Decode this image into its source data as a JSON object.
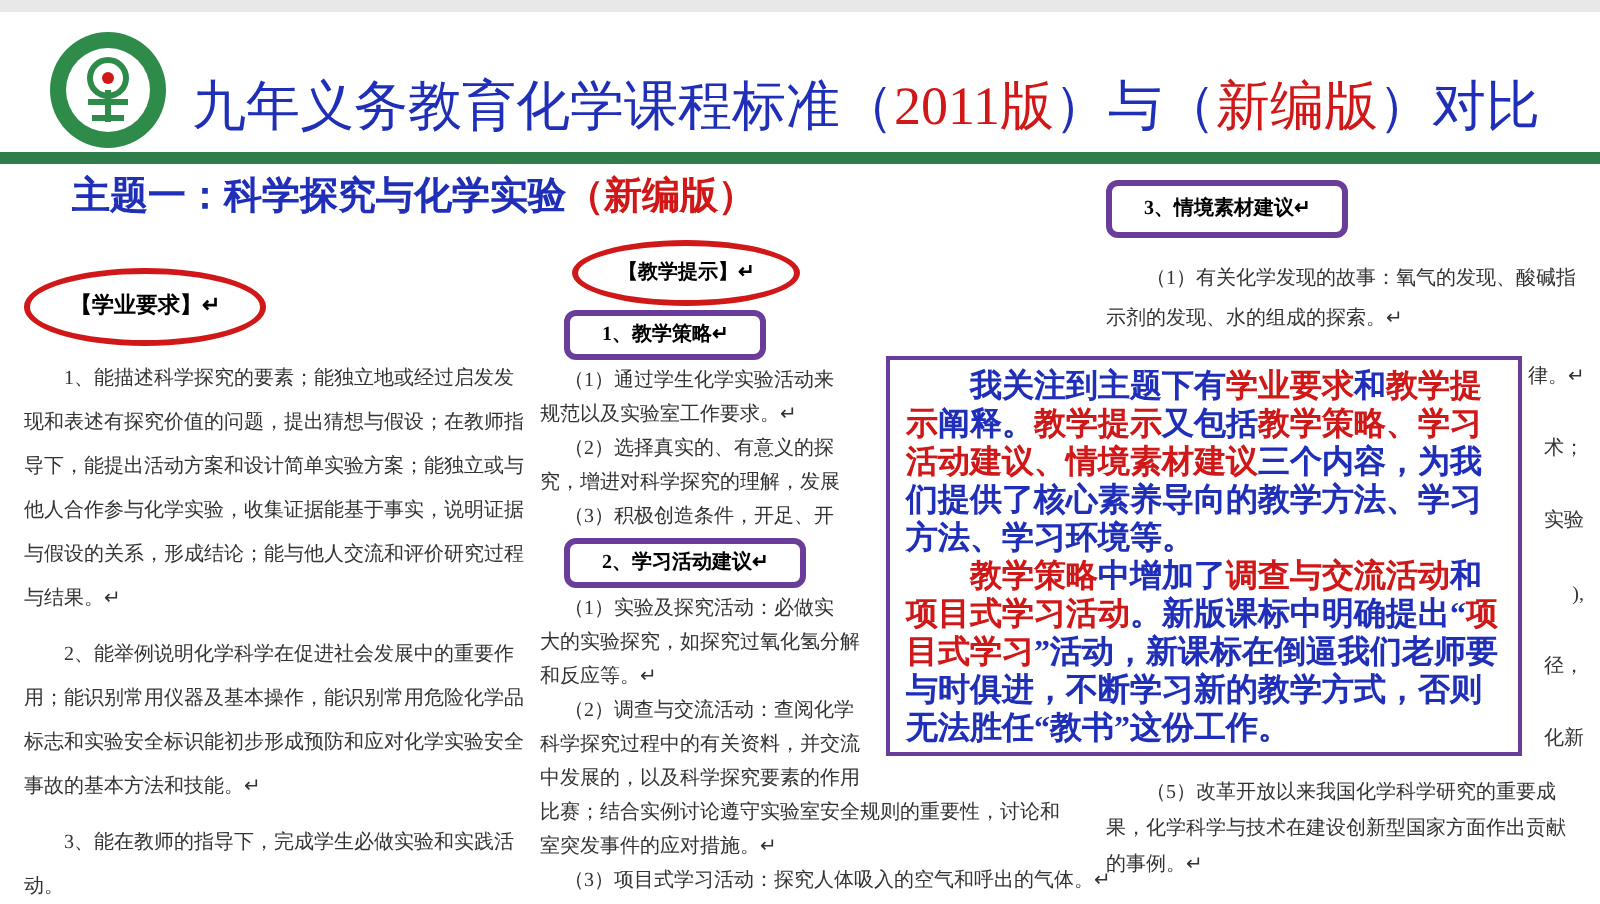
{
  "title": [
    {
      "text": "九年义务教育化学课程标准（",
      "emphasis": false
    },
    {
      "text": "2011版",
      "emphasis": true
    },
    {
      "text": "）与（",
      "emphasis": false
    },
    {
      "text": "新编版",
      "emphasis": true
    },
    {
      "text": "）对比",
      "emphasis": false
    }
  ],
  "subtitle": [
    {
      "text": "主题一：科学探究与化学实验",
      "emphasis": false
    },
    {
      "text": "（新编版）",
      "emphasis": true
    }
  ],
  "left_doc": {
    "heading": "【学业要求】↵",
    "paragraphs": [
      "1、能描述科学探究的要素；能独立地或经过启发发现和表述有探究价值的问题，提出猜想与假设；在教师指导下，能提出活动方案和设计简单实验方案；能独立或与他人合作参与化学实验，收集证据能基于事实，说明证据与假设的关系，形成结论；能与他人交流和评价研究过程与结果。↵",
      "2、能举例说明化学科学在促进社会发展中的重要作用；能识别常用仪器及基本操作，能识别常用危险化学品标志和实验安全标识能初步形成预防和应对化学实验安全事故的基本方法和技能。↵",
      "3、能在教师的指导下，完成学生必做实验和实践活动。"
    ]
  },
  "middle_doc": {
    "heading": "【教学提示】↵",
    "sections": [
      {
        "title": "1、教学策略↵",
        "lines": [
          {
            "text": "（1）通过学生化学实验活动来",
            "indent": true
          },
          {
            "text": "规范以及实验室工作要求。↵",
            "indent": false
          },
          {
            "text": "（2）选择真实的、有意义的探",
            "indent": true
          },
          {
            "text": "究，增进对科学探究的理解，发展",
            "indent": false
          },
          {
            "text": "（3）积极创造条件，开足、开",
            "indent": true
          }
        ]
      },
      {
        "title": "2、学习活动建议↵",
        "lines": [
          {
            "text": "（1）实验及探究活动：必做实",
            "indent": true
          },
          {
            "text": "大的实验探究，如探究过氧化氢分解",
            "indent": false
          },
          {
            "text": "和反应等。↵",
            "indent": false
          },
          {
            "text": "（2）调查与交流活动：查阅化学",
            "indent": true
          },
          {
            "text": "科学探究过程中的有关资料，并交流",
            "indent": false
          },
          {
            "text": "中发展的，以及科学探究要素的作用",
            "indent": false
          },
          {
            "text": "比赛；结合实例讨论遵守实验室安全规则的重要性，讨论和",
            "indent": false
          },
          {
            "text": "室突发事件的应对措施。↵",
            "indent": false
          },
          {
            "text": "（3）项目式学习活动：探究人体吸入的空气和呼出的气体。↵",
            "indent": true
          }
        ]
      }
    ]
  },
  "right_doc": {
    "heading": "3、情境素材建议↵",
    "paragraph": "（1）有关化学发现的故事：氧气的发现、酸碱指示剂的发现、水的组成的探索。↵",
    "fragments": [
      "律。↵",
      "术；",
      "实验",
      "),",
      "径，",
      "化新"
    ],
    "last_paragraph": "（5）改革开放以来我国化学科学研究的重要成果，化学科学与技术在建设创新型国家方面作出贡献的事例。↵"
  },
  "callout": {
    "paragraphs": [
      [
        {
          "text": "我关注到主题下有",
          "emphasis": false
        },
        {
          "text": "学业要求",
          "emphasis": true
        },
        {
          "text": "和",
          "emphasis": false
        },
        {
          "text": "教学提示",
          "emphasis": true
        },
        {
          "text": "阐释。",
          "emphasis": false
        },
        {
          "text": "教学提示",
          "emphasis": true
        },
        {
          "text": "又包括",
          "emphasis": false
        },
        {
          "text": "教学策略、学习活动建议、情境素材建议",
          "emphasis": true
        },
        {
          "text": "三个内容，为我们提供了核心素养导向的教学方法、学习方法、学习环境等。",
          "emphasis": false
        }
      ],
      [
        {
          "text": "教学策略",
          "emphasis": true
        },
        {
          "text": "中增加了",
          "emphasis": false
        },
        {
          "text": "调查与交流活动",
          "emphasis": true
        },
        {
          "text": "和",
          "emphasis": false
        },
        {
          "text": "项目式学习活动",
          "emphasis": true
        },
        {
          "text": "。新版课标中明确提出“",
          "emphasis": false
        },
        {
          "text": "项目式学习",
          "emphasis": true
        },
        {
          "text": "”活动，新课标在倒逼我们老师要与时俱进，不断学习新的教学方式，否则无法胜任“教书”这份工作。",
          "emphasis": false
        }
      ]
    ]
  }
}
